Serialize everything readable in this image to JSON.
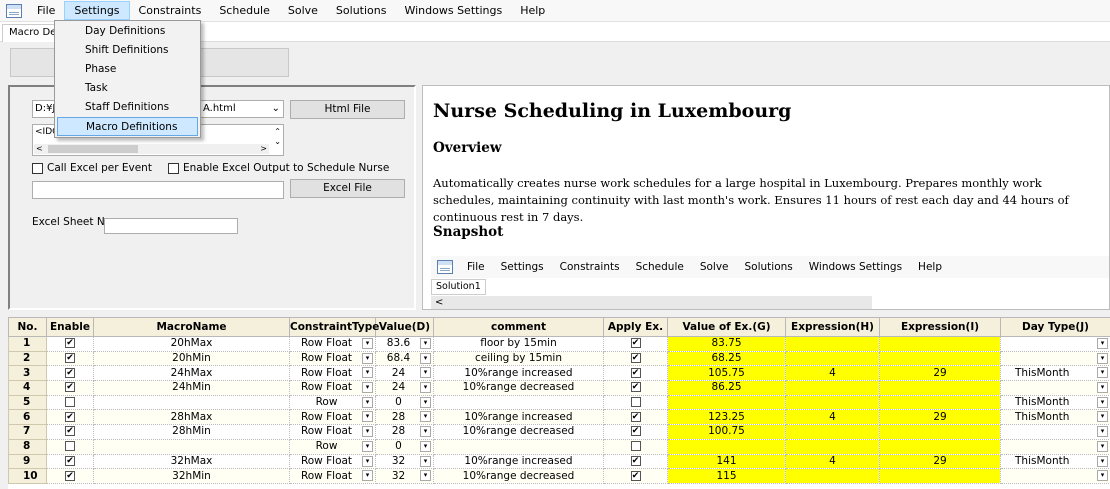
{
  "menubar": {
    "items": [
      "File",
      "Settings",
      "Constraints",
      "Schedule",
      "Solve",
      "Solutions",
      "Windows Settings",
      "Help"
    ]
  },
  "tab": {
    "label": "Macro Def"
  },
  "settings_menu": {
    "items": [
      "Day Definitions",
      "Shift Definitions",
      "Phase",
      "Task",
      "Staff Definitions",
      "Macro Definitions"
    ],
    "selected": "Macro Definitions"
  },
  "form": {
    "path_prefix": "D:¥Jr",
    "path_suffix": "A.html",
    "html_button": "Html File",
    "memo_text": "<IDO",
    "call_excel_label": "Call Excel per Event",
    "enable_excel_label": "Enable Excel Output to Schedule Nurse",
    "excel_button": "Excel File",
    "sheet_label": "Excel Sheet Name"
  },
  "doc": {
    "title": "Nurse Scheduling in Luxembourg",
    "overview_heading": "Overview",
    "overview_text": "Automatically creates nurse work schedules for a large hospital in Luxembourg. Prepares monthly work schedules, maintaining continuity with last month's work. Ensures 11 hours of rest each day and 44 hours of continuous rest in 7 days.",
    "snapshot_heading": "Snapshot",
    "snapshot_menu": [
      "File",
      "Settings",
      "Constraints",
      "Schedule",
      "Solve",
      "Solutions",
      "Windows Settings",
      "Help"
    ],
    "snapshot_tab": "Solution1",
    "snapshot_scroll_left": "<"
  },
  "grid": {
    "headers": [
      "No.",
      "Enable",
      "MacroName",
      "ConstraintType",
      "Value(D)",
      "comment",
      "Apply Ex.",
      "Value of Ex.(G)",
      "Expression(H)",
      "Expression(I)",
      "Day Type(J)"
    ],
    "rows": [
      {
        "no": "1",
        "enable": true,
        "name": "20hMax",
        "type": "Row Float",
        "value": "83.6",
        "comment": "floor by 15min",
        "apply": true,
        "vex": "83.75",
        "h": "",
        "i": "",
        "day": ""
      },
      {
        "no": "2",
        "enable": true,
        "name": "20hMin",
        "type": "Row Float",
        "value": "68.4",
        "comment": "ceiling by 15min",
        "apply": true,
        "vex": "68.25",
        "h": "",
        "i": "",
        "day": ""
      },
      {
        "no": "3",
        "enable": true,
        "name": "24hMax",
        "type": "Row Float",
        "value": "24",
        "comment": "10%range increased",
        "apply": true,
        "vex": "105.75",
        "h": "4",
        "i": "29",
        "day": "ThisMonth"
      },
      {
        "no": "4",
        "enable": true,
        "name": "24hMin",
        "type": "Row Float",
        "value": "24",
        "comment": "10%range decreased",
        "apply": true,
        "vex": "86.25",
        "h": "",
        "i": "",
        "day": ""
      },
      {
        "no": "5",
        "enable": false,
        "name": "",
        "type": "Row",
        "value": "0",
        "comment": "",
        "apply": false,
        "vex": "",
        "h": "",
        "i": "",
        "day": "ThisMonth"
      },
      {
        "no": "6",
        "enable": true,
        "name": "28hMax",
        "type": "Row Float",
        "value": "28",
        "comment": "10%range increased",
        "apply": true,
        "vex": "123.25",
        "h": "4",
        "i": "29",
        "day": "ThisMonth"
      },
      {
        "no": "7",
        "enable": true,
        "name": "28hMin",
        "type": "Row Float",
        "value": "28",
        "comment": "10%range decreased",
        "apply": true,
        "vex": "100.75",
        "h": "",
        "i": "",
        "day": ""
      },
      {
        "no": "8",
        "enable": false,
        "name": "",
        "type": "Row",
        "value": "0",
        "comment": "",
        "apply": false,
        "vex": "",
        "h": "",
        "i": "",
        "day": ""
      },
      {
        "no": "9",
        "enable": true,
        "name": "32hMax",
        "type": "Row Float",
        "value": "32",
        "comment": "10%range increased",
        "apply": true,
        "vex": "141",
        "h": "4",
        "i": "29",
        "day": "ThisMonth"
      },
      {
        "no": "10",
        "enable": true,
        "name": "32hMin",
        "type": "Row Float",
        "value": "32",
        "comment": "10%range decreased",
        "apply": true,
        "vex": "115",
        "h": "",
        "i": "",
        "day": ""
      }
    ]
  },
  "colors": {
    "highlight": "#ffff00",
    "header_bg": "#f5f0dc",
    "menu_selected": "#cde8ff"
  }
}
